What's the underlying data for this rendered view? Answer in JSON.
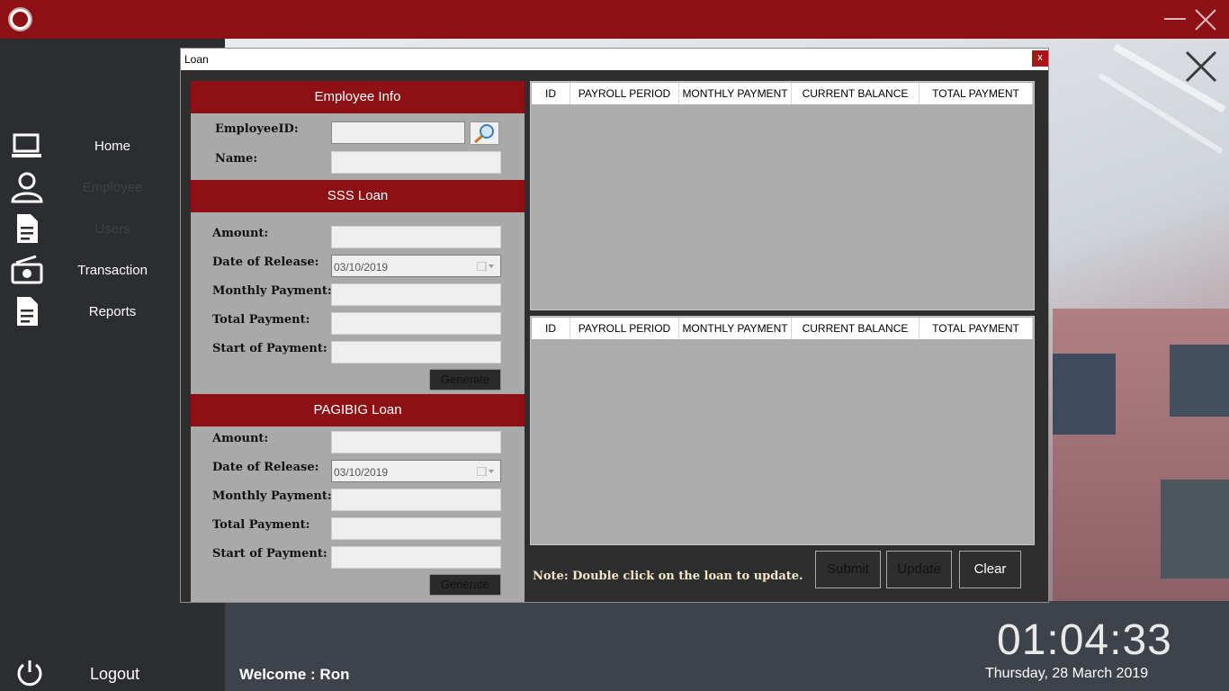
{
  "app": {
    "logo_icon": "university-seal-icon",
    "accent": "#8d1015"
  },
  "sidebar": {
    "items": [
      {
        "label": "Home",
        "icon": "laptop-icon",
        "enabled": true
      },
      {
        "label": "Employee",
        "icon": "user-icon",
        "enabled": false
      },
      {
        "label": "Users",
        "icon": "document-icon",
        "enabled": false
      },
      {
        "label": "Transaction",
        "icon": "cash-icon",
        "enabled": true
      },
      {
        "label": "Reports",
        "icon": "document-icon",
        "enabled": true
      }
    ],
    "logout_label": "Logout"
  },
  "status": {
    "welcome": "Welcome : Ron",
    "time": "01:04:33",
    "date": "Thursday, 28 March 2019"
  },
  "dialog": {
    "title": "Loan",
    "close_label": "x",
    "employee_info": {
      "header": "Employee Info",
      "employee_id_label": "EmployeeID:",
      "employee_id_value": "",
      "name_label": "Name:",
      "name_value": ""
    },
    "sss": {
      "header": "SSS Loan",
      "amount_label": "Amount:",
      "release_label": "Date of Release:",
      "release_value": "03/10/2019",
      "monthly_label": "Monthly Payment:",
      "total_label": "Total Payment:",
      "start_label": "Start of Payment:",
      "generate_label": "Generate"
    },
    "pagibig": {
      "header": "PAGIBIG Loan",
      "amount_label": "Amount:",
      "release_label": "Date of Release:",
      "release_value": "03/10/2019",
      "monthly_label": "Monthly Payment:",
      "total_label": "Total Payment:",
      "start_label": "Start of Payment:",
      "generate_label": "Generate"
    },
    "grid_columns": [
      "ID",
      "PAYROLL PERIOD",
      "MONTHLY PAYMENT",
      "CURRENT BALANCE",
      "TOTAL PAYMENT"
    ],
    "grid1_rows": [],
    "grid2_rows": [],
    "note": "Note: Double click on the loan to update.",
    "buttons": {
      "submit": "Submit",
      "update": "Update",
      "clear": "Clear"
    }
  }
}
